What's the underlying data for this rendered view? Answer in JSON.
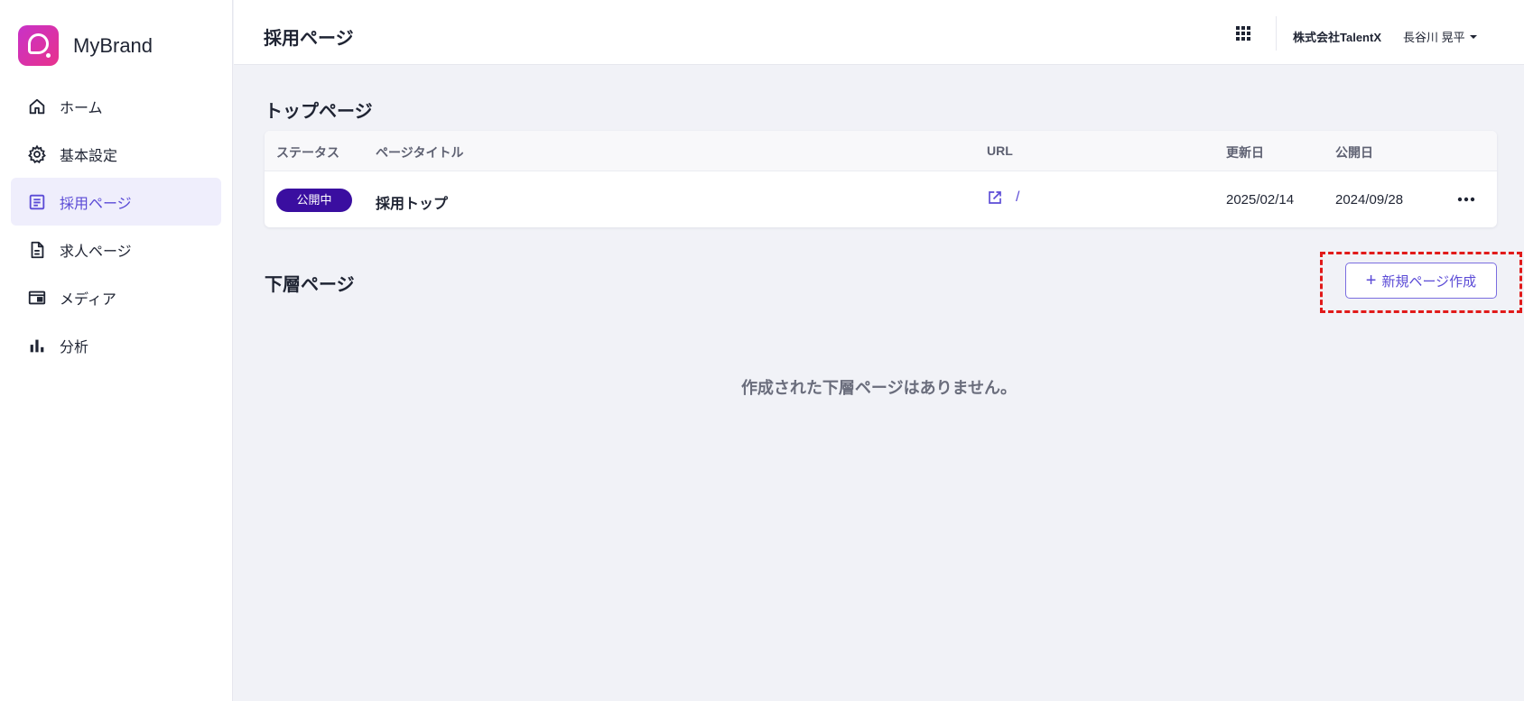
{
  "brand": {
    "name": "MyBrand"
  },
  "sidebar": {
    "items": [
      {
        "label": "ホーム",
        "icon": "home-icon"
      },
      {
        "label": "基本設定",
        "icon": "gear-icon"
      },
      {
        "label": "採用ページ",
        "icon": "document-list-icon",
        "active": true
      },
      {
        "label": "求人ページ",
        "icon": "file-icon"
      },
      {
        "label": "メディア",
        "icon": "media-icon"
      },
      {
        "label": "分析",
        "icon": "bar-chart-icon"
      }
    ]
  },
  "header": {
    "title": "採用ページ",
    "company": "株式会社TalentX",
    "user": "長谷川 晃平"
  },
  "top_section": {
    "title": "トップページ",
    "columns": [
      "ステータス",
      "ページタイトル",
      "URL",
      "更新日",
      "公開日"
    ],
    "rows": [
      {
        "status": "公開中",
        "title": "採用トップ",
        "url": "/",
        "updated": "2025/02/14",
        "published": "2024/09/28"
      }
    ]
  },
  "lower_section": {
    "title": "下層ページ",
    "new_button": "新規ページ作成",
    "empty_message": "作成された下層ページはありません。"
  },
  "colors": {
    "accent": "#5b4bd6",
    "status_badge": "#3a0ea0",
    "highlight": "#e11a1a",
    "brand_gradient_start": "#c832c8",
    "brand_gradient_end": "#e8328c"
  }
}
